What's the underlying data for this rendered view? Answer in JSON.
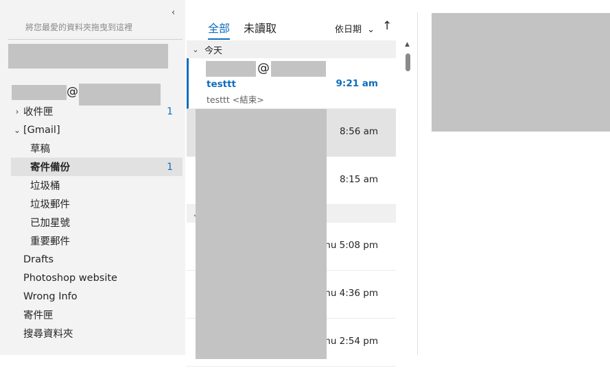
{
  "folder_pane": {
    "collapse_icon": "‹",
    "favorites_hint": "將您最愛的資料夾拖曳到這裡",
    "account_at": "@",
    "folders": [
      {
        "label": "收件匣",
        "chevron": "›",
        "count": "1"
      },
      {
        "label": "[Gmail]",
        "chevron": "⌄",
        "count": ""
      },
      {
        "label": "草稿",
        "count": ""
      },
      {
        "label": "寄件備份",
        "count": "1",
        "selected": true
      },
      {
        "label": "垃圾桶",
        "count": ""
      },
      {
        "label": "垃圾郵件",
        "count": ""
      },
      {
        "label": "已加星號",
        "count": ""
      },
      {
        "label": "重要郵件",
        "count": ""
      },
      {
        "label": "Drafts",
        "count": ""
      },
      {
        "label": "Photoshop website",
        "count": ""
      },
      {
        "label": "Wrong Info",
        "count": ""
      },
      {
        "label": "寄件匣",
        "count": ""
      },
      {
        "label": "搜尋資料夾",
        "count": ""
      }
    ]
  },
  "message_list": {
    "tabs": {
      "all": "全部",
      "unread": "未讀取"
    },
    "sort_label": "依日期",
    "sort_chevron": "⌄",
    "sort_direction_icon": "↑",
    "groups": {
      "today": "今天"
    },
    "group_chevron": "⌄",
    "messages": [
      {
        "sender_at": "@",
        "subject": "testtt",
        "preview": "testtt <結束>",
        "time": "9:21 am",
        "unread": true
      },
      {
        "time": "8:56 am"
      },
      {
        "time": "8:15 am"
      },
      {
        "time": "Thu 5:08 pm"
      },
      {
        "time": "Thu 4:36 pm"
      },
      {
        "time": "Thu 2:54 pm"
      }
    ]
  },
  "colors": {
    "accent": "#0f6cbd",
    "redaction": "#c3c3c3",
    "folder_bg": "#f3f3f3",
    "selected_bg": "#e1e1e1"
  }
}
